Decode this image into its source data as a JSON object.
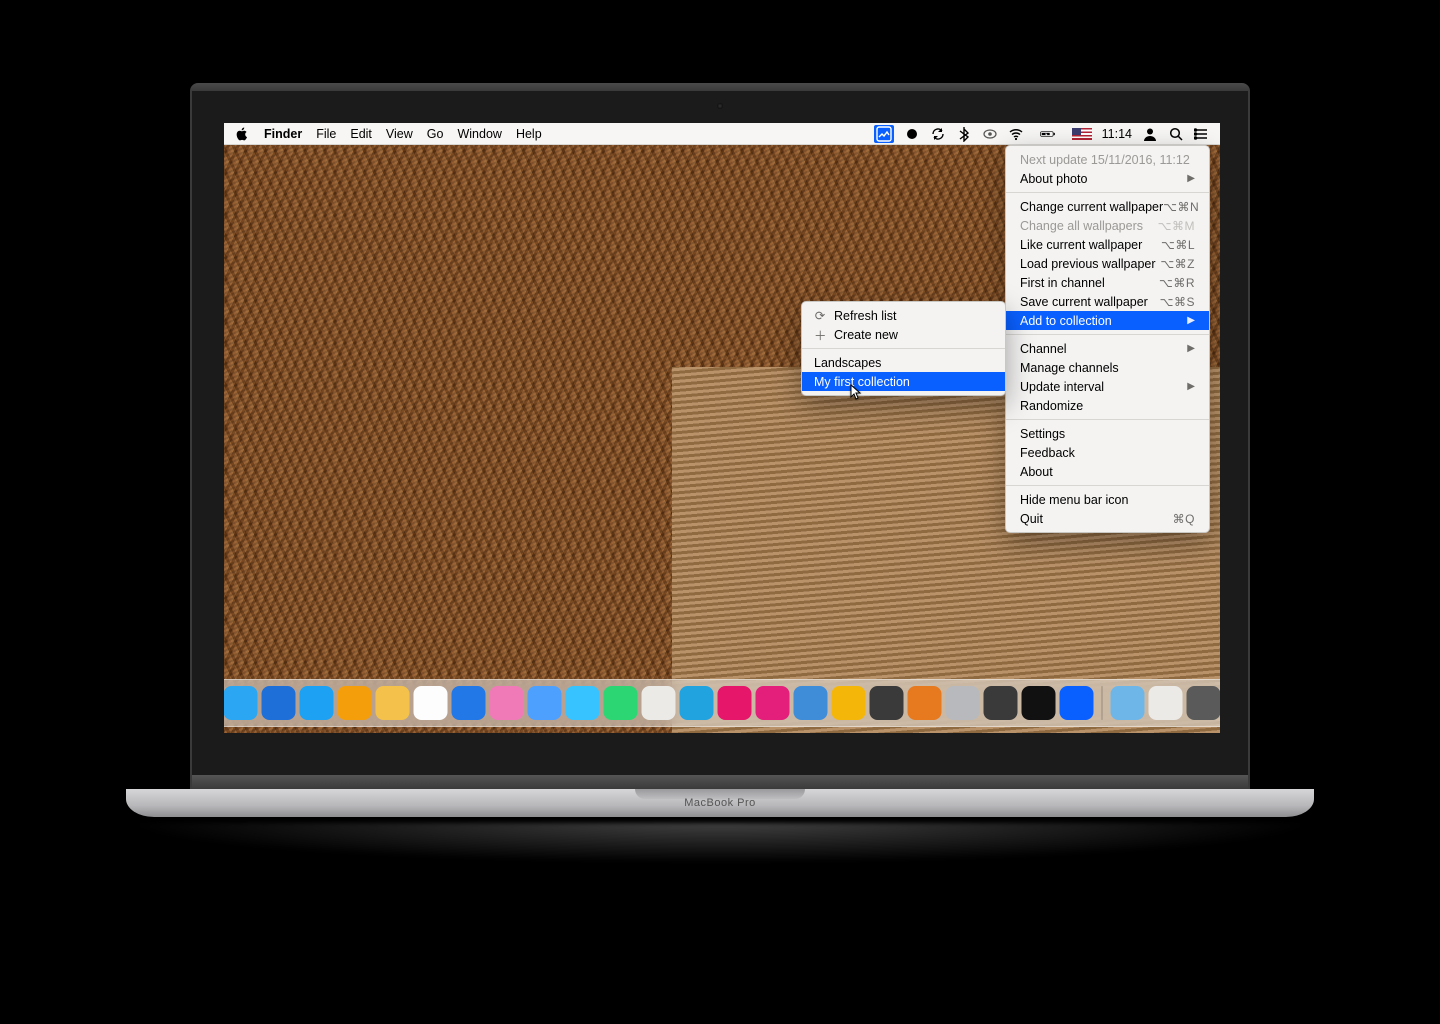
{
  "device": {
    "brand": "MacBook Pro"
  },
  "menubar": {
    "app": "Finder",
    "items": [
      "File",
      "Edit",
      "View",
      "Go",
      "Window",
      "Help"
    ],
    "clock": "11:14"
  },
  "dropdown": {
    "next_update": "Next update 15/11/2016, 11:12",
    "about_photo": "About photo",
    "change_current": {
      "label": "Change current wallpaper",
      "shortcut": "⌥⌘N"
    },
    "change_all": {
      "label": "Change all wallpapers",
      "shortcut": "⌥⌘M"
    },
    "like": {
      "label": "Like current wallpaper",
      "shortcut": "⌥⌘L"
    },
    "load_prev": {
      "label": "Load previous wallpaper",
      "shortcut": "⌥⌘Z"
    },
    "first": {
      "label": "First in channel",
      "shortcut": "⌥⌘R"
    },
    "save": {
      "label": "Save current wallpaper",
      "shortcut": "⌥⌘S"
    },
    "add_collection": "Add to collection",
    "channel": "Channel",
    "manage_channels": "Manage channels",
    "update_interval": "Update interval",
    "randomize": "Randomize",
    "settings": "Settings",
    "feedback": "Feedback",
    "about": "About",
    "hide": "Hide menu bar icon",
    "quit": {
      "label": "Quit",
      "shortcut": "⌘Q"
    }
  },
  "submenu": {
    "refresh": "Refresh list",
    "create": "Create new",
    "collections": [
      "Landscapes",
      "My first collection"
    ]
  },
  "dock_colors": [
    "#2aa6f2",
    "#1f6fd8",
    "#1da1f2",
    "#f59e0b",
    "#f4c24a",
    "#fdfdfd",
    "#2178e6",
    "#f07ab8",
    "#4ea0ff",
    "#37c3ff",
    "#2bd673",
    "#eceae7",
    "#21a3e0",
    "#e6166b",
    "#e41f7b",
    "#3f8dd9",
    "#f5b60a",
    "#3a3a3a",
    "#e7791f",
    "#b7b9bc",
    "#3a3a3a",
    "#111111",
    "#0a60ff",
    "#6fb6e8",
    "#eceae7",
    "#5a5a5a"
  ]
}
